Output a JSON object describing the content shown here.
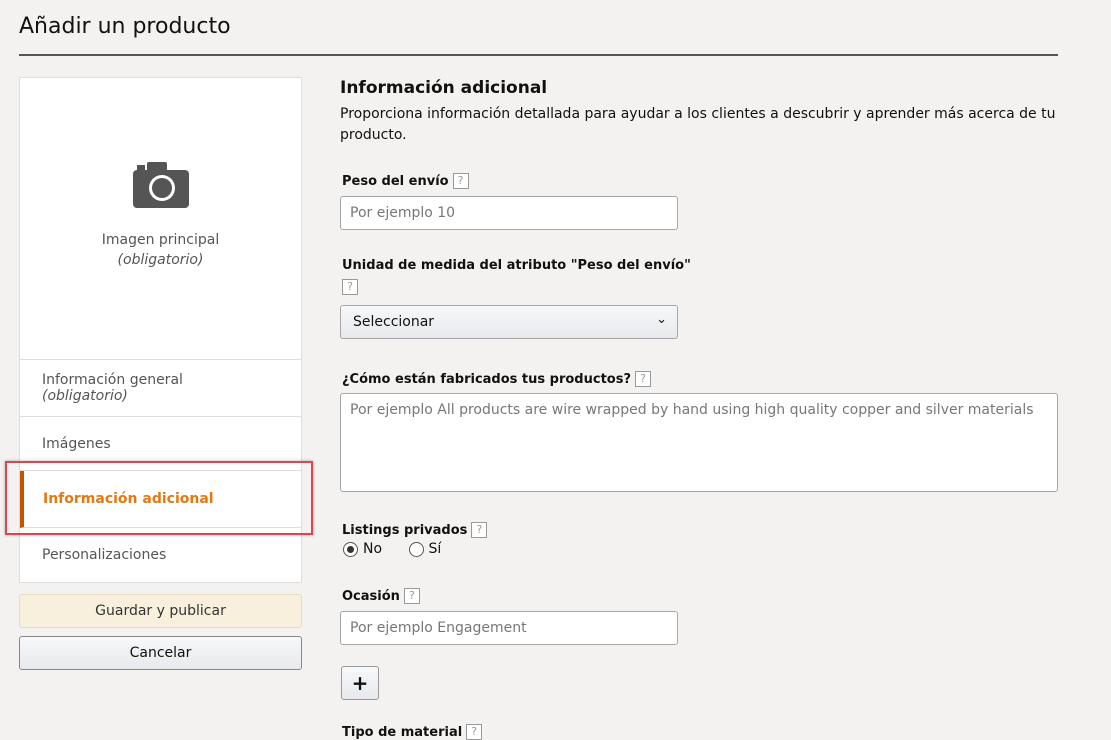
{
  "page": {
    "title": "Añadir un producto"
  },
  "sidebar": {
    "image_label": "Imagen principal",
    "image_required": "(obligatorio)",
    "items": [
      {
        "label": "Información general",
        "sub": "(obligatorio)"
      },
      {
        "label": "Imágenes"
      },
      {
        "label": "Información adicional"
      },
      {
        "label": "Personalizaciones"
      }
    ],
    "save_label": "Guardar y publicar",
    "cancel_label": "Cancelar"
  },
  "main": {
    "heading": "Información adicional",
    "description": "Proporciona información detallada para ayudar a los clientes a descubrir y aprender más acerca de tu producto.",
    "help": "?",
    "weight": {
      "label": "Peso del envío",
      "placeholder": "Por ejemplo 10"
    },
    "unit": {
      "label": "Unidad de medida del atributo \"Peso del envío\"",
      "value": "Seleccionar"
    },
    "how_made": {
      "label": "¿Cómo están fabricados tus productos?",
      "placeholder": "Por ejemplo All products are wire wrapped by hand using high quality copper and silver materials"
    },
    "private": {
      "label": "Listings privados",
      "options": [
        "No",
        "Sí"
      ],
      "selected": "No"
    },
    "occasion": {
      "label": "Ocasión",
      "placeholder": "Por ejemplo Engagement"
    },
    "add_label": "+",
    "material": {
      "label": "Tipo de material"
    }
  },
  "colors": {
    "accent": "#e47911",
    "active_bar": "#c45500",
    "highlight": "#e0454f"
  }
}
